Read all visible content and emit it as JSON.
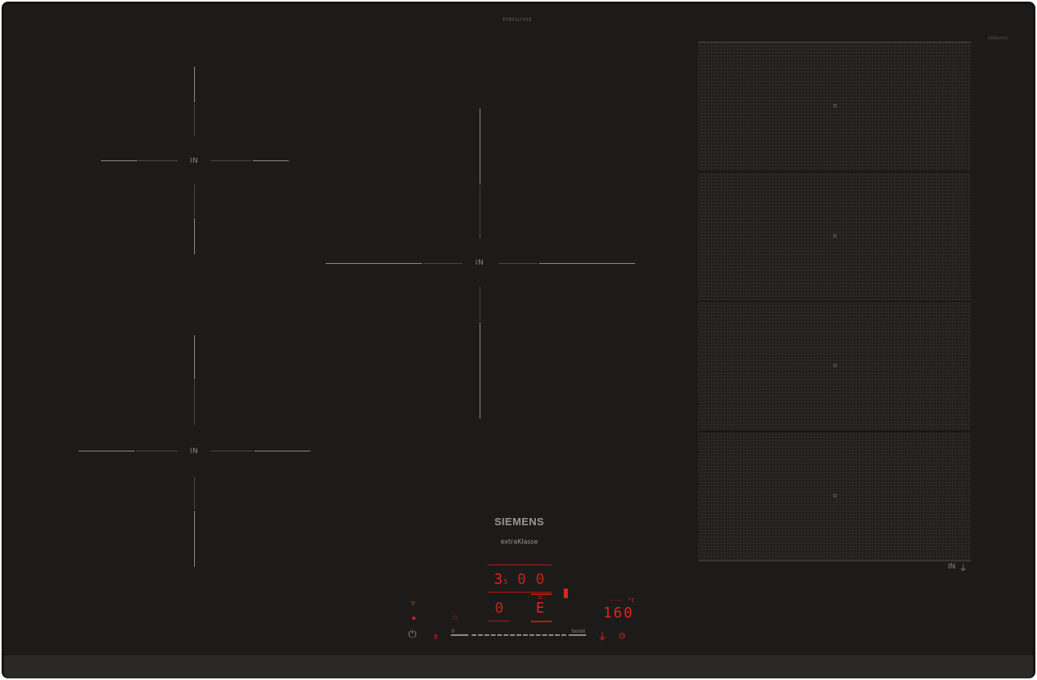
{
  "product": {
    "model_code": "EX801LYX1E",
    "model_code_right": "EX801LYX1E",
    "brand": "SIEMENS",
    "sub_brand": "extraKlasse"
  },
  "zones": {
    "front_left_label": "IN",
    "rear_left_label": "IN",
    "center_label": "IN",
    "flex_label": "IN"
  },
  "display": {
    "timer_digits": [
      "3",
      "5",
      "0",
      "0"
    ],
    "zone_level": "0",
    "zone_mode": "E",
    "temperature": "160",
    "temperature_unit": "°C",
    "slider_start": "0",
    "slider_end": "boost"
  },
  "icons": {
    "power": "power-icon",
    "wifi": "wifi-icon",
    "favorite": "star-icon",
    "pause": "pause-icon",
    "fry_sensor": "frying-sensor-icon",
    "timer": "clock-icon",
    "flex": "flex-zone-icon"
  },
  "colors": {
    "glass": "#1c1b1a",
    "display_red": "#e0241c",
    "markings": "#8b8987"
  }
}
